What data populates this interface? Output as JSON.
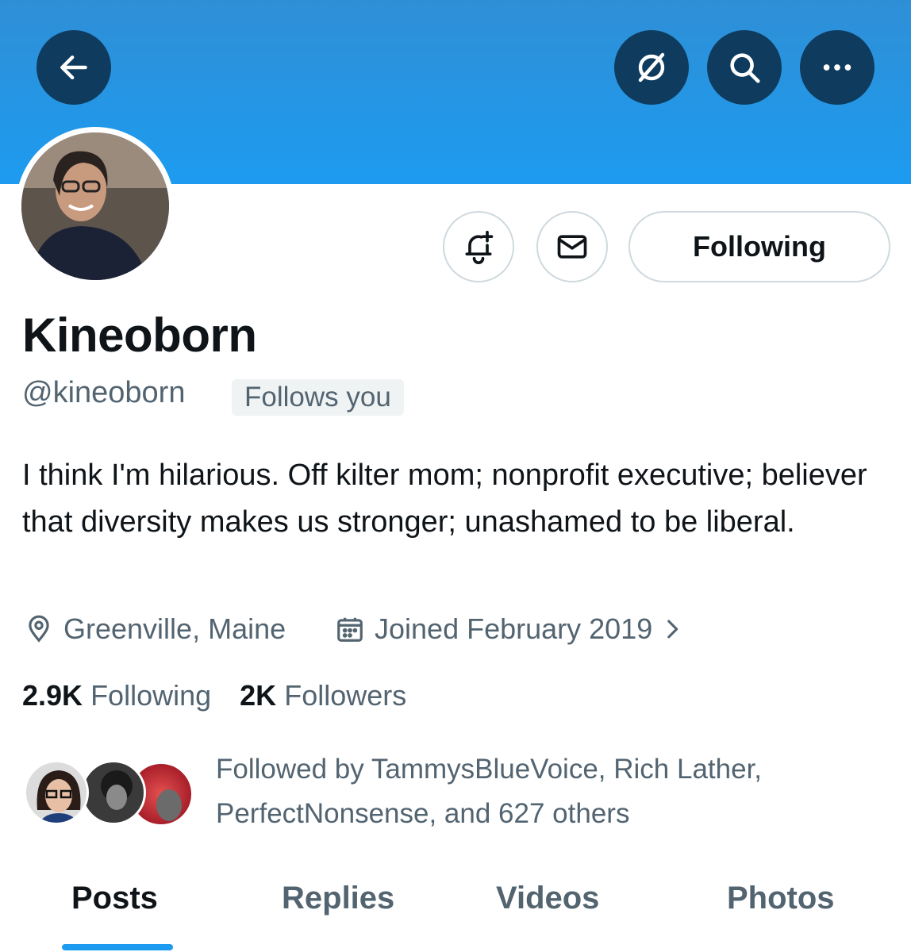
{
  "header": {
    "back_icon": "arrow-left-icon",
    "grok_icon": "grok-icon",
    "search_icon": "search-icon",
    "more_icon": "more-horizontal-icon"
  },
  "profile": {
    "display_name": "Kineoborn",
    "handle": "@kineoborn",
    "follows_you_badge": "Follows you",
    "bio": "I think I'm hilarious. Off kilter mom; nonprofit executive; believer that diversity makes us stronger; unashamed to be liberal.",
    "location": "Greenville, Maine",
    "joined": "Joined February 2019",
    "following_count": "2.9K",
    "following_label": "Following",
    "followers_count": "2K",
    "followers_label": "Followers",
    "followed_by": "Followed by TammysBlueVoice, Rich Lather, PerfectNonsense, and 627 others"
  },
  "actions": {
    "notify_icon": "bell-plus-icon",
    "message_icon": "mail-icon",
    "following_button": "Following"
  },
  "tabs": [
    {
      "label": "Posts",
      "active": true
    },
    {
      "label": "Replies",
      "active": false
    },
    {
      "label": "Videos",
      "active": false
    },
    {
      "label": "Photos",
      "active": false
    }
  ],
  "colors": {
    "accent": "#1d9bf0",
    "banner": "#1d9bf0",
    "secondary_text": "#536471",
    "primary_text": "#0f1419"
  }
}
